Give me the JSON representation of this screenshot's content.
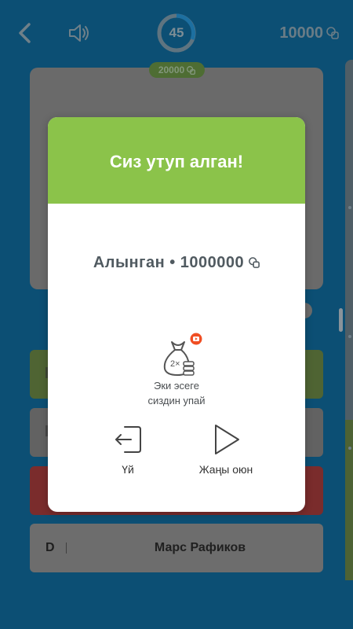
{
  "header": {
    "timer_value": "45",
    "balance": "10000",
    "prize": "20000"
  },
  "answers": {
    "d_letter": "D",
    "d_text": "Марс Рафиков"
  },
  "modal": {
    "title": "Сиз утуп алган!",
    "win_label": "Алынган • 1000000",
    "double_badge": "2×",
    "double_text_line1": "Эки эсеге",
    "double_text_line2": "сиздин упай",
    "home_label": "Үй",
    "new_game_label": "Жаңы оюн"
  },
  "colors": {
    "header_green": "#8bc34a",
    "overlay_blue": "#0c4f74",
    "video_badge": "#f04e23"
  },
  "icons": {
    "back": "chevron-left-icon",
    "sound": "speaker-icon",
    "coin": "coin-stack-icon",
    "bag": "money-bag-icon",
    "video": "play-video-icon",
    "home": "exit-door-icon",
    "play": "play-triangle-icon"
  }
}
